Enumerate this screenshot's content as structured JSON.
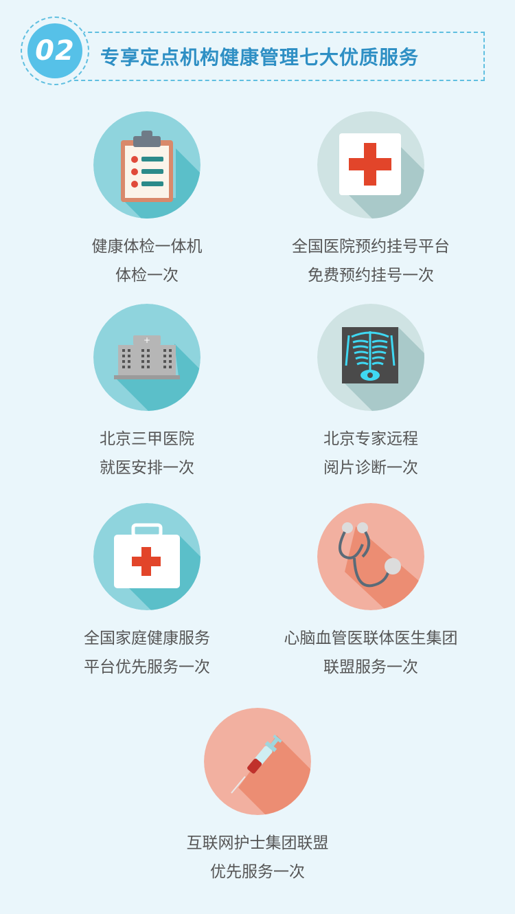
{
  "header": {
    "number": "02",
    "title": "专享定点机构健康管理七大优质服务"
  },
  "services": [
    {
      "line1": "健康体检一体机",
      "line2": "体检一次",
      "icon": "clipboard-icon"
    },
    {
      "line1": "全国医院预约挂号平台",
      "line2": "免费预约挂号一次",
      "icon": "red-cross-icon"
    },
    {
      "line1": "北京三甲医院",
      "line2": "就医安排一次",
      "icon": "hospital-building-icon"
    },
    {
      "line1": "北京专家远程",
      "line2": "阅片诊断一次",
      "icon": "xray-icon"
    },
    {
      "line1": "全国家庭健康服务",
      "line2": "平台优先服务一次",
      "icon": "first-aid-kit-icon"
    },
    {
      "line1": "心脑血管医联体医生集团",
      "line2": "联盟服务一次",
      "icon": "stethoscope-icon"
    },
    {
      "line1": "互联网护士集团联盟",
      "line2": "优先服务一次",
      "icon": "syringe-icon"
    }
  ],
  "colors": {
    "teal": "#8fd4dd",
    "teal_shadow": "#5bbfc9",
    "salmon": "#f2b0a0",
    "salmon_shadow": "#ec8d73",
    "accent": "#2e8fc4"
  }
}
